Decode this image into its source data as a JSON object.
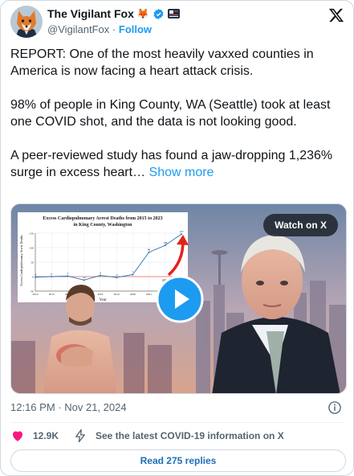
{
  "author": {
    "display_name": "The Vigilant Fox",
    "emoji_badges": "🦊",
    "handle": "@VigilantFox",
    "separator": "·",
    "follow_label": "Follow"
  },
  "tweet": {
    "paragraphs": [
      "REPORT: One of the most heavily vaxxed counties in America is now facing a heart attack crisis.",
      "98% of people in King County, WA (Seattle) took at least one COVID shot, and the data is not looking good.",
      "A peer-reviewed study has found a jaw-dropping 1,236% surge in excess heart…"
    ],
    "show_more": "Show more"
  },
  "media": {
    "watch_label": "Watch on X",
    "chart_title_1": "Excess Cardiopulmonary Arrest Deaths from 2015 to 2023",
    "chart_title_2": "in King County, Washington",
    "chart_xlabel": "Year",
    "chart_ylabel": "Excess Cardiopulmonary Arrest Deaths",
    "chart_threshold_label": "2019"
  },
  "meta": {
    "time": "12:16 PM",
    "separator": "·",
    "date": "Nov 21, 2024"
  },
  "actions": {
    "likes": "12.9K",
    "info_link": "See the latest COVID-19 information on X"
  },
  "replies_button": "Read 275 replies",
  "colors": {
    "accent": "#1d9bf0",
    "like": "#f91880",
    "text": "#0f1419",
    "muted": "#536471",
    "border": "#cfd9de"
  },
  "chart_data": {
    "type": "line",
    "title": "Excess Cardiopulmonary Arrest Deaths from 2015 to 2023 in King County, Washington",
    "xlabel": "Year",
    "ylabel": "Excess Cardiopulmonary Arrest Deaths",
    "x": [
      "2014",
      "2015",
      "2016",
      "2017",
      "2018",
      "2019",
      "2020",
      "2021",
      "2022",
      "2023"
    ],
    "series": [
      {
        "values": [
          -2,
          0,
          2,
          -12,
          4,
          -3,
          7,
          84,
          108,
          147
        ]
      }
    ],
    "ylim": [
      -50,
      150
    ],
    "yticks": [
      "150",
      "100",
      "50",
      "0",
      "-50"
    ],
    "xticks": [
      "2014",
      "2015",
      "2016",
      "2017",
      "2018",
      "2019",
      "2020",
      "2021",
      "2022"
    ],
    "data_labels": [
      "-2",
      "0",
      "2",
      "-12",
      "4",
      "-3",
      "7",
      "84",
      "108",
      "147"
    ],
    "annotations": [
      "2019"
    ]
  }
}
